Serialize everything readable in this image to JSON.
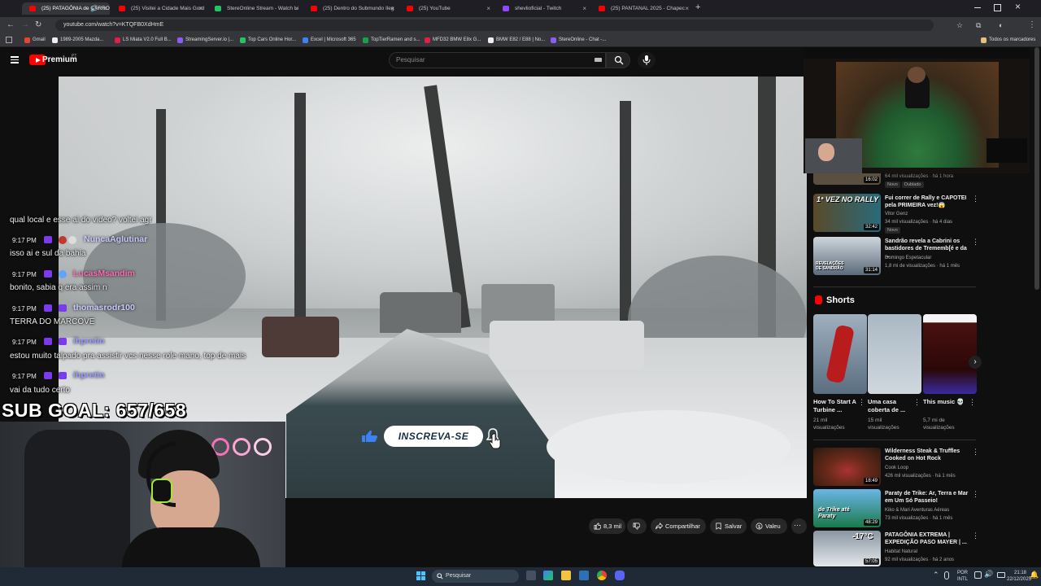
{
  "browser": {
    "tabs": [
      {
        "label": "(25) PATAGÔNIA de CARRO",
        "active": true,
        "color": "#ff0000"
      },
      {
        "label": "(25) Visitei a Cidade Mais Gord",
        "color": "#ff0000"
      },
      {
        "label": "StereOnline Stream - Watch Li",
        "color": "#22c55e"
      },
      {
        "label": "(25) Dentro do Submundo Ileg",
        "color": "#ff0000"
      },
      {
        "label": "(25) YouTube",
        "color": "#ff0000"
      },
      {
        "label": "shevlioficial - Twitch",
        "color": "#9146ff"
      },
      {
        "label": "(25) PANTANAL 2025 - Chapec",
        "color": "#ff0000"
      }
    ],
    "new_tab_glyph": "+",
    "url": "youtube.com/watch?v=KTQFB0XdHmE",
    "bookmarks": [
      {
        "label": "Gmail",
        "color": "#ea4335"
      },
      {
        "label": "1989-2005 Mazda...",
        "color": "#eee"
      },
      {
        "label": "LS Miata V2.0 Full B...",
        "color": "#e11d48"
      },
      {
        "label": "StreamingServer.io |...",
        "color": "#8b5cf6"
      },
      {
        "label": "Top Cars Online Hor...",
        "color": "#22c55e"
      },
      {
        "label": "Excel | Microsoft 365",
        "color": "#3b82f6"
      },
      {
        "label": "TopTierRamen and s...",
        "color": "#16a34a"
      },
      {
        "label": "MFD32 BMW E8x G...",
        "color": "#e11d48"
      },
      {
        "label": "BMW E82 / E88 | No...",
        "color": "#eee"
      },
      {
        "label": "StereOnline - Chat -...",
        "color": "#8b5cf6"
      }
    ],
    "all_bookmarks": "Todos os marcadores"
  },
  "youtube": {
    "logo_text": "Premium",
    "country_code": "PT",
    "search_placeholder": "Pesquisar",
    "subscribe_label": "INSCREVA-SE",
    "actions": {
      "like_count": "8,3 mil",
      "share": "Compartilhar",
      "save": "Salvar",
      "thanks": "Valeu",
      "more": "···"
    },
    "sidebar": {
      "partial_meta": "64 mil visualizações · há 1 hora",
      "partial_duration": "16:02",
      "partial_badges": [
        "Novo",
        "Dublado"
      ],
      "videos": [
        {
          "title": "Fui correr de Rally e CAPOTEI pela PRIMEIRA vez!😱",
          "channel": "Vitor Genz",
          "meta": "34 mil visualizações · há 4 dias",
          "duration": "32:42",
          "badge": "Novo",
          "thumb_text": "1ª VEZ NO RALLY",
          "thumb_color": "#5a4a2a"
        },
        {
          "title": "Sandrão revela a Cabrini os bastidores de Trememb[é e da ...",
          "channel": "Domingo Espetacular",
          "meta": "1,8 mi de visualizações · há 1 mês",
          "duration": "31:14",
          "thumb_text": "REVELAÇÕES DE SANDRÃO",
          "thumb_color": "#5b6b7a"
        }
      ],
      "shorts_heading": "Shorts",
      "shorts": [
        {
          "title": "How To Start A Turbine ...",
          "views": "21 mil visualizações",
          "thumb_color": "#7a8fa0"
        },
        {
          "title": "Uma casa coberta de ...",
          "views": "15 mil visualizações",
          "thumb_color": "#9fb0bf"
        },
        {
          "title": "This music 💀",
          "views": "5,7 mi de visualizações",
          "thumb_color": "#4a1010"
        }
      ],
      "videos_after": [
        {
          "title": "Wilderness Steak & Truffles Cooked on Hot Rock",
          "channel": "Cook Loop",
          "meta": "426 mil visualizações · há 1 mês",
          "duration": "18:49",
          "thumb_color": "#6a2a1a"
        },
        {
          "title": "Paraty de Trike: Ar, Terra e Mar em Um Só Passeio!",
          "channel": "Kiko & Mari Aventuras Aéreas",
          "meta": "73 mil visualizações · há 1 mês",
          "duration": "48:29",
          "thumb_text": "de Trike até Paraty",
          "thumb_color": "#1a7a4a"
        },
        {
          "title": "PATAGÔNIA EXTREMA | EXPEDIÇÃO PASO MAYER | ...",
          "channel": "Habitat Natural",
          "meta": "92 mil visualizações · há 2 anos",
          "duration": "57:05",
          "thumb_text": "-17°C",
          "thumb_color": "#aeb9c4"
        }
      ]
    }
  },
  "stream_overlay": {
    "chat": [
      {
        "message": "qual local e esse ai do video? voltei agr"
      },
      {
        "time": "9:17 PM",
        "user": "NuncaAglutinar",
        "user_color": "#c8c8ff",
        "message": "isso ai e sul da bahia"
      },
      {
        "time": "9:17 PM",
        "user": "LucasMsandim",
        "user_color": "#ff69b4",
        "message": "bonito, sabia q era assim n"
      },
      {
        "time": "9:17 PM",
        "user": "thomasrodr100",
        "user_color": "#c8c8ff",
        "message": "TERRA DO MARCOVE"
      },
      {
        "time": "9:17 PM",
        "user": "ihpretin",
        "user_color": "#9a9aff",
        "message": "estou muito talpado pra assistir vcs nesse role mano, top de mais"
      },
      {
        "time": "9:17 PM",
        "user": "ihpretin",
        "user_color": "#9a9aff",
        "message": "vai da tudo certo"
      }
    ],
    "sub_goal": "SUB GOAL: 657/658"
  },
  "taskbar": {
    "search_placeholder": "Pesquisar",
    "lang_top": "POR",
    "lang_bottom": "INTL",
    "time": "21:18",
    "date": "22/12/2025"
  }
}
